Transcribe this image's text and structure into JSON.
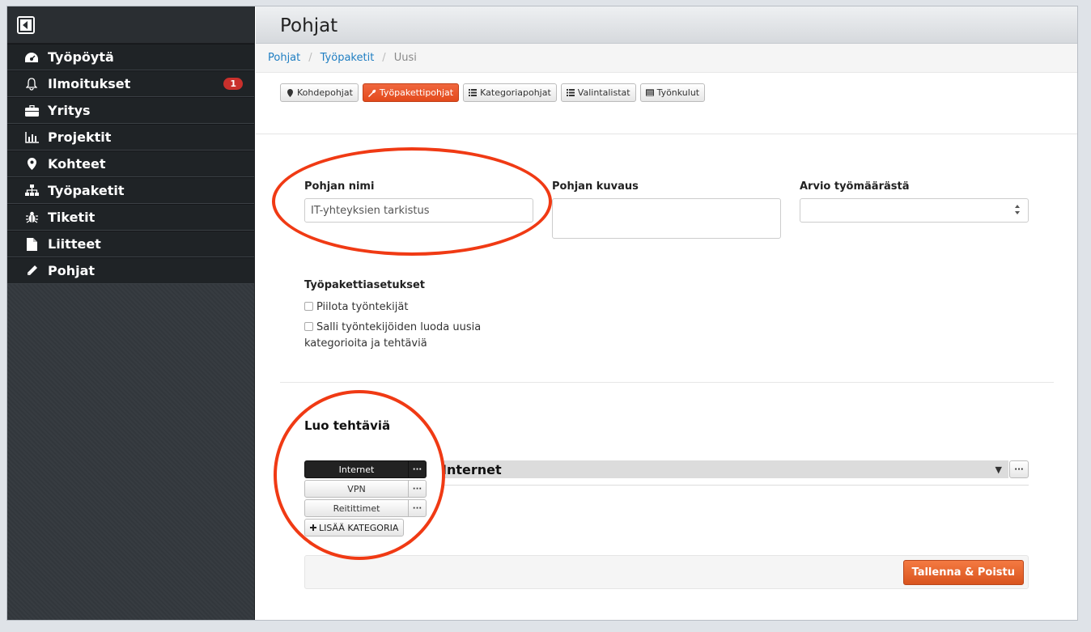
{
  "sidebar": {
    "items": [
      {
        "label": "Työpöytä",
        "icon": "dashboard-icon"
      },
      {
        "label": "Ilmoitukset",
        "icon": "bell-icon",
        "badge": "1"
      },
      {
        "label": "Yritys",
        "icon": "briefcase-icon"
      },
      {
        "label": "Projektit",
        "icon": "bar-chart-icon"
      },
      {
        "label": "Kohteet",
        "icon": "map-marker-icon"
      },
      {
        "label": "Työpaketit",
        "icon": "sitemap-icon"
      },
      {
        "label": "Tiketit",
        "icon": "bug-icon"
      },
      {
        "label": "Liitteet",
        "icon": "file-icon"
      },
      {
        "label": "Pohjat",
        "icon": "pencil-icon"
      }
    ]
  },
  "header": {
    "title": "Pohjat"
  },
  "breadcrumb": [
    "Pohjat",
    "Työpaketit",
    "Uusi"
  ],
  "tabs": [
    {
      "label": "Kohdepohjat",
      "icon": "map-marker-icon"
    },
    {
      "label": "Työpakettipohjat",
      "icon": "wrench-icon",
      "active": true
    },
    {
      "label": "Kategoriapohjat",
      "icon": "list-icon"
    },
    {
      "label": "Valintalistat",
      "icon": "list-icon"
    },
    {
      "label": "Työnkulut",
      "icon": "tasks-icon"
    }
  ],
  "form": {
    "name_label": "Pohjan nimi",
    "name_value": "IT-yhteyksien tarkistus",
    "description_label": "Pohjan kuvaus",
    "description_value": "",
    "estimate_label": "Arvio työmäärästä",
    "estimate_value": "",
    "settings_title": "Työpakettiasetukset",
    "settings": [
      {
        "label": "Piilota työntekijät",
        "checked": false
      },
      {
        "label": "Salli työntekijöiden luoda uusia kategorioita ja tehtäviä",
        "checked": false
      }
    ]
  },
  "tasks": {
    "title": "Luo tehtäviä",
    "categories": [
      {
        "label": "Internet",
        "active": true
      },
      {
        "label": "VPN",
        "active": false
      },
      {
        "label": "Reitittimet",
        "active": false
      }
    ],
    "more_label": "···",
    "add_category_label": "LISÄÄ KATEGORIA",
    "selected_category": "Internet"
  },
  "actions": {
    "save_label": "Tallenna & Poistu"
  },
  "colors": {
    "accent": "#e34a1c",
    "annotation": "#f03a14",
    "sidebar": "#1f2326"
  }
}
